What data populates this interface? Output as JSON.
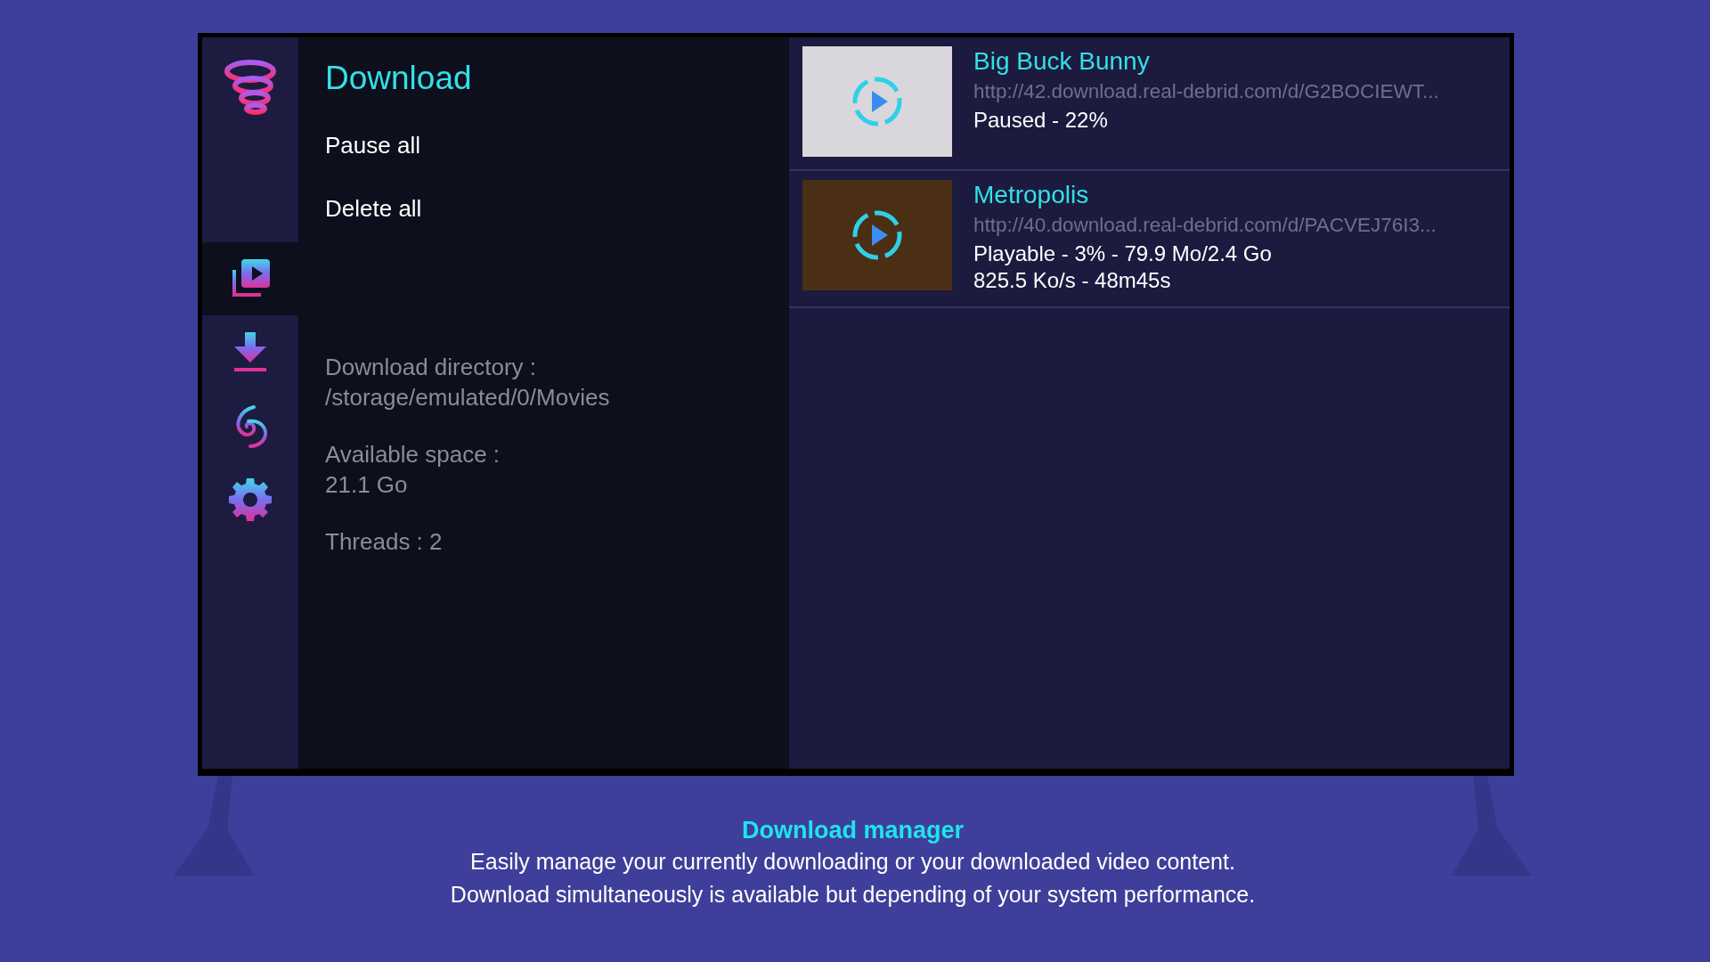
{
  "sidebar": {
    "items": [
      {
        "kind": "library",
        "selected": true
      },
      {
        "kind": "download",
        "selected": false
      },
      {
        "kind": "spiral",
        "selected": false
      },
      {
        "kind": "settings",
        "selected": false
      }
    ]
  },
  "panel": {
    "title": "Download",
    "actions": [
      "Pause all",
      "Delete all"
    ],
    "info": [
      {
        "lines": [
          "Download directory :",
          "/storage/emulated/0/Movies"
        ]
      },
      {
        "lines": [
          "Available space :",
          "21.1 Go"
        ]
      },
      {
        "lines": [
          "Threads : 2"
        ]
      }
    ]
  },
  "downloads": [
    {
      "title": "Big Buck Bunny",
      "url": "http://42.download.real-debrid.com/d/G2BOCIEWT...",
      "status": [
        "Paused - 22%"
      ]
    },
    {
      "title": "Metropolis",
      "url": "http://40.download.real-debrid.com/d/PACVEJ76I3...",
      "status": [
        "Playable - 3% - 79.9 Mo/2.4 Go",
        "825.5 Ko/s - 48m45s"
      ]
    }
  ],
  "caption": {
    "title": "Download manager",
    "lines": [
      "Easily manage your currently downloading or your downloaded video content.",
      "Download simultaneously is available but depending of your system performance."
    ]
  }
}
